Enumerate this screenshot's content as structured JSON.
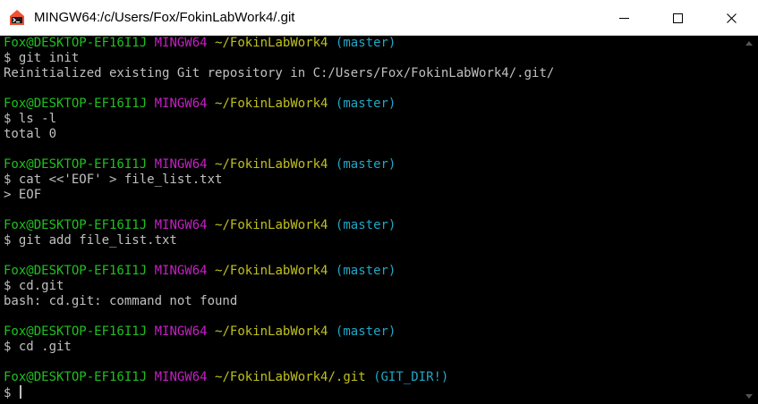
{
  "window": {
    "title": "MINGW64:/c/Users/Fox/FokinLabWork4/.git",
    "icon": "git-bash-icon"
  },
  "controls": {
    "minimize": "minimize-icon",
    "maximize": "maximize-icon",
    "close": "close-icon"
  },
  "colors": {
    "user": "#1fc01f",
    "system": "#c71fc7",
    "path": "#c0c01f",
    "branch": "#1fa7c7",
    "text": "#c0c0c0",
    "background": "#000000"
  },
  "terminal": {
    "blocks": [
      {
        "prompt": {
          "user": "Fox@DESKTOP-EF16I1J",
          "system": "MINGW64",
          "path": "~/FokinLabWork4",
          "branch": "(master)"
        },
        "command": "$ git init",
        "output": [
          "Reinitialized existing Git repository in C:/Users/Fox/FokinLabWork4/.git/"
        ]
      },
      {
        "prompt": {
          "user": "Fox@DESKTOP-EF16I1J",
          "system": "MINGW64",
          "path": "~/FokinLabWork4",
          "branch": "(master)"
        },
        "command": "$ ls -l",
        "output": [
          "total 0"
        ]
      },
      {
        "prompt": {
          "user": "Fox@DESKTOP-EF16I1J",
          "system": "MINGW64",
          "path": "~/FokinLabWork4",
          "branch": "(master)"
        },
        "command": "$ cat <<'EOF' > file_list.txt",
        "output": [
          "> EOF"
        ]
      },
      {
        "prompt": {
          "user": "Fox@DESKTOP-EF16I1J",
          "system": "MINGW64",
          "path": "~/FokinLabWork4",
          "branch": "(master)"
        },
        "command": "$ git add file_list.txt",
        "output": []
      },
      {
        "prompt": {
          "user": "Fox@DESKTOP-EF16I1J",
          "system": "MINGW64",
          "path": "~/FokinLabWork4",
          "branch": "(master)"
        },
        "command": "$ cd.git",
        "output": [
          "bash: cd.git: command not found"
        ]
      },
      {
        "prompt": {
          "user": "Fox@DESKTOP-EF16I1J",
          "system": "MINGW64",
          "path": "~/FokinLabWork4",
          "branch": "(master)"
        },
        "command": "$ cd .git",
        "output": []
      }
    ],
    "current": {
      "prompt": {
        "user": "Fox@DESKTOP-EF16I1J",
        "system": "MINGW64",
        "path": "~/FokinLabWork4/.git",
        "branch": "(GIT_DIR!)"
      },
      "input": "$ "
    }
  }
}
